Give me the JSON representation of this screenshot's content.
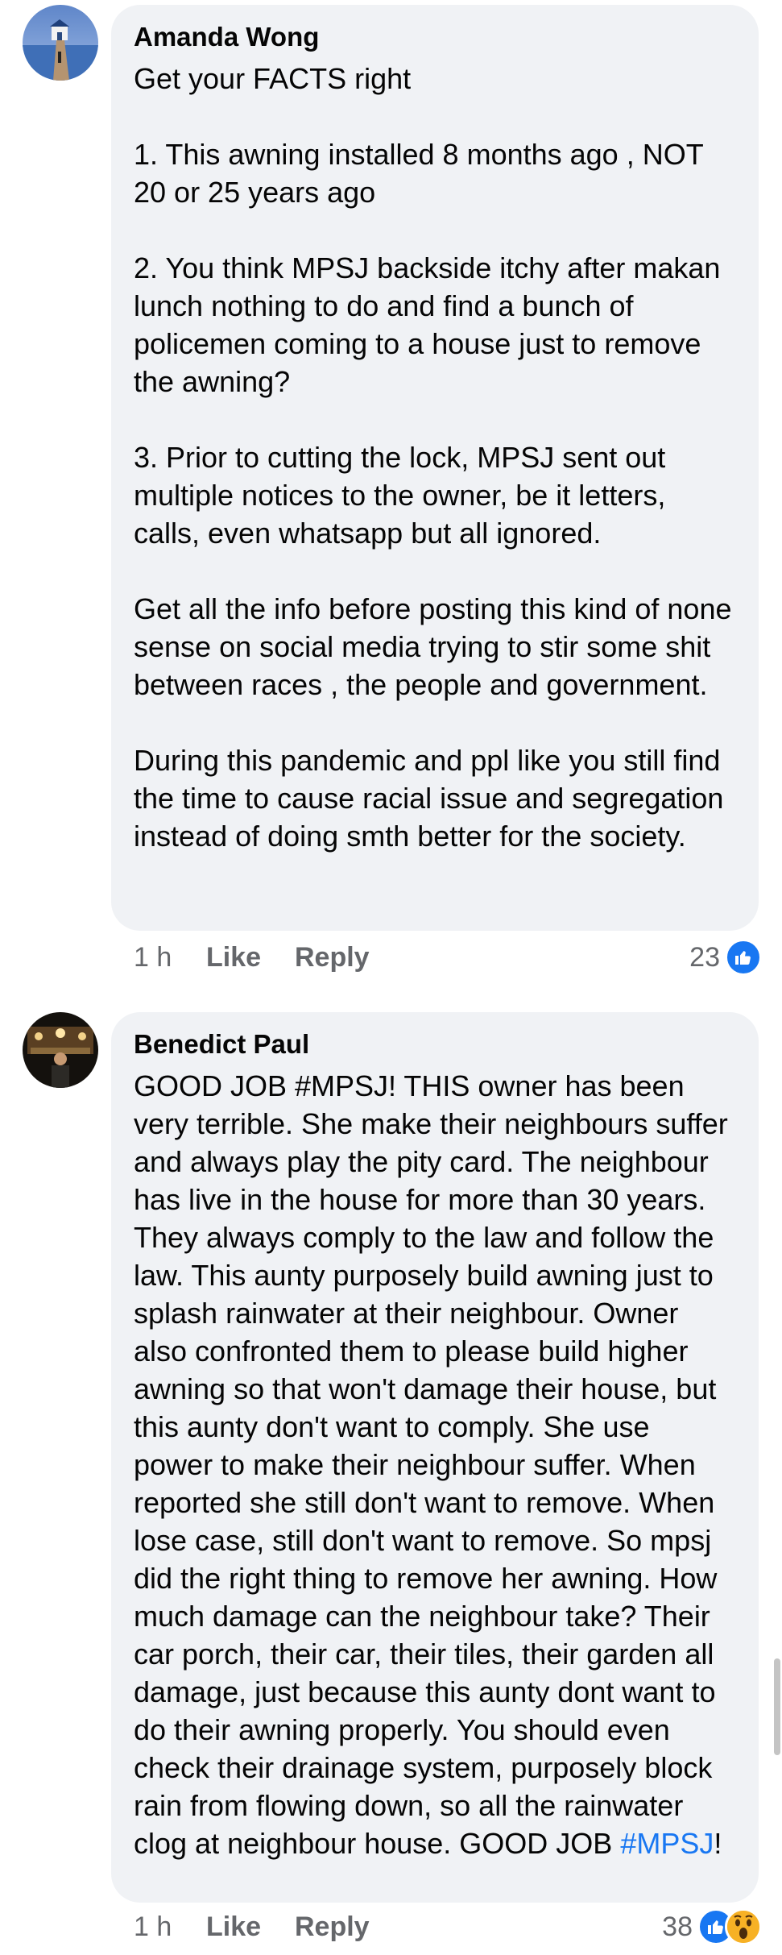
{
  "comments": [
    {
      "author": "Amanda Wong",
      "text": "Get your FACTS right\n\n1. This awning installed 8 months ago , NOT 20 or 25 years ago\n\n2. You think MPSJ backside itchy after makan lunch nothing to do and find a bunch of policemen coming to a house just to remove the awning?\n\n3. Prior to cutting the lock, MPSJ sent out multiple notices to the owner,  be it letters, calls, even whatsapp but all ignored.\n\nGet all the info before posting this kind of none sense on social media trying to stir some shit between races , the people and government.\n\nDuring this pandemic and ppl like you still find the time to cause racial issue and segregation instead of doing smth better for the society.",
      "time": "1 h",
      "like_label": "Like",
      "reply_label": "Reply",
      "reaction_count": "23",
      "reactions": [
        "like-icon"
      ]
    },
    {
      "author": "Benedict Paul",
      "text": "GOOD JOB #MPSJ! THIS owner has been very terrible. She make their neighbours suffer and always play the pity card. The neighbour has live in the house for more than 30 years. They always comply to the law and follow the law. This aunty purposely build awning just to splash rainwater at their neighbour. Owner also confronted them to please build higher awning so that won't damage their house, but this aunty don't want to comply. She use power to make their neighbour suffer. When reported she still don't want to remove. When lose case, still don't want to remove. So mpsj did the right thing to remove her awning. How much damage can the neighbour take? Their car porch, their car, their tiles, their garden all damage, just because this aunty dont want to do their awning properly. You should even check their drainage system, purposely block rain from flowing down, so all the rainwater clog at neighbour house. GOOD JOB ",
      "hashtag": "#MPSJ",
      "text_end": "!",
      "time": "1 h",
      "like_label": "Like",
      "reply_label": "Reply",
      "reaction_count": "38",
      "reactions": [
        "like-icon",
        "wow-icon"
      ]
    }
  ],
  "colors": {
    "bubble": "#f0f2f5",
    "meta": "#65676b",
    "link": "#1877f2",
    "like": "#1877f2",
    "wow": "#f7b125"
  }
}
